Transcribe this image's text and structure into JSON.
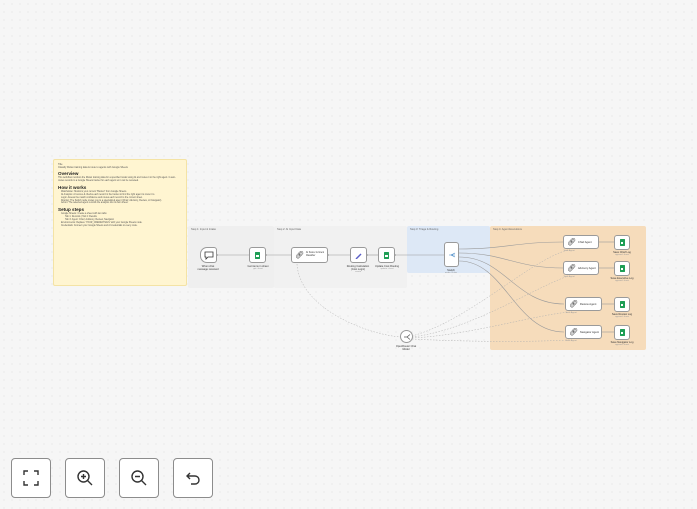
{
  "notes": {
    "main": {
      "line1": "Title",
      "line2": "Classify Rivian training data & route to agents with Google Sheets",
      "overview_title": "Overview",
      "overview_text": "This workflow monitors the Rivian training data for a specified model using AI and routes it to the right agent. It auto-routes records to a Google Sheets tracker for each agent so it can be reviewed.",
      "how_title": "How it works",
      "how_items": [
        "Watchdown: Monitors your current \"Bucket\" from Google Sheets.",
        "AI Analysis: AI scores & checks each record in the bucket to find the right agent to route it to.",
        "Logic: Assess the match confidence and routes each record to the correct sheet.",
        "Routing: The Switch node routes you to a specialized agent (Chief, Advisory, Review, or Navigator).",
        "Action: The selected agent records the analysis into its own sheet."
      ],
      "setup_title": "Setup steps",
      "setup_items": [
        "Google Sheets: Create a sheet with two tabs:",
        "Tab 1: Records  |  Tab 2: Results",
        "Tab 3: Agent: Chief, Advisory, Review, Navigator",
        "Environments: Replace 'YOUR_CREDENTIALS' with your Google Sheets node.",
        "Credentials: Connect your Google Sheets and AI credentials to every node."
      ]
    },
    "step1": "Step 1: Input & Intake",
    "step2": "Step 2: AI Input Data",
    "step3": "Step 3: Triage & Routing",
    "step4": "Step 4: Agent Executions"
  },
  "nodes": {
    "chat_trigger": {
      "label": "When chat message received",
      "icon": "chat-icon"
    },
    "get_sheet": {
      "label": "Get items in sheet",
      "sub": "get: sheet"
    },
    "ai_scorer": {
      "label": "AI Scorer & Intent Classifier",
      "icon": "link-icon"
    },
    "routing_logic": {
      "label": "Routing Calculation (Cost Logic)",
      "sub": "create",
      "icon": "pencil-icon"
    },
    "update_routing": {
      "label": "Update Cost Routing",
      "sub": "update: sheet"
    },
    "switch": {
      "label": "Switch",
      "sub": "mode: Rules",
      "icon": "switch-icon"
    },
    "openrouter": {
      "label": "OpenRouter Chat Model",
      "icon": "openrouter-icon"
    },
    "chief_agent": {
      "label": "Chief Agent",
      "sub": "Tools Agent"
    },
    "advisory_agent": {
      "label": "Advisory Agent",
      "sub": "Tools Agent"
    },
    "review_agent": {
      "label": "Review Agent",
      "sub": "Tools Agent"
    },
    "navigator_agent": {
      "label": "Navigator Agent",
      "sub": "Tools Agent"
    },
    "save_chief": {
      "label": "Save Chief Log",
      "sub": "append: sheet"
    },
    "save_executive": {
      "label": "Save Executive Log",
      "sub": "append: sheet"
    },
    "save_review": {
      "label": "Save Review Log",
      "sub": "append: sheet"
    },
    "save_navigator": {
      "label": "Save Navigator Log",
      "sub": "append: sheet"
    }
  },
  "controls": {
    "fit": "fit-view-icon",
    "zoom_in": "zoom-in-icon",
    "zoom_out": "zoom-out-icon",
    "undo": "undo-icon"
  },
  "colors": {
    "note_yellow": "#fff5d1",
    "note_gray": "#efefef",
    "note_blue": "#dde8f6",
    "note_orange": "#f6dcbb",
    "sheets_green": "#1e9e55"
  }
}
